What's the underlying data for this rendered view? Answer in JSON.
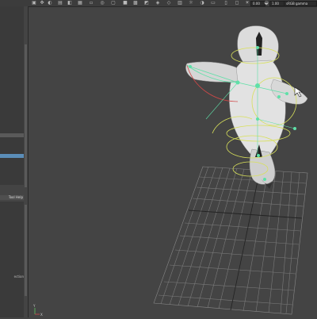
{
  "toolbar": {
    "field_value_1": "0.00",
    "field_value_2": "1.00",
    "color_space_label": "sRGB gamma",
    "icons": [
      "move-icon",
      "rotate-icon",
      "scale-icon",
      "snap-icon",
      "grid-icon",
      "camera-icon",
      "light-icon",
      "wireframe-icon",
      "shaded-icon",
      "texture-icon",
      "shadow-icon",
      "isolate-icon",
      "xray-icon",
      "render-icon"
    ]
  },
  "left_panel": {
    "tool_tab_label": "Tool Help",
    "bottom_text": "ection"
  },
  "viewport": {
    "axis_label_y": "Y",
    "axis_label_x": "X",
    "colors": {
      "background": "#444444",
      "grid": "#777777",
      "body": "#d8d8d8",
      "rig_green": "#5fe0a8",
      "rig_yellow": "#d8e05a",
      "rig_red": "#d04848"
    }
  }
}
